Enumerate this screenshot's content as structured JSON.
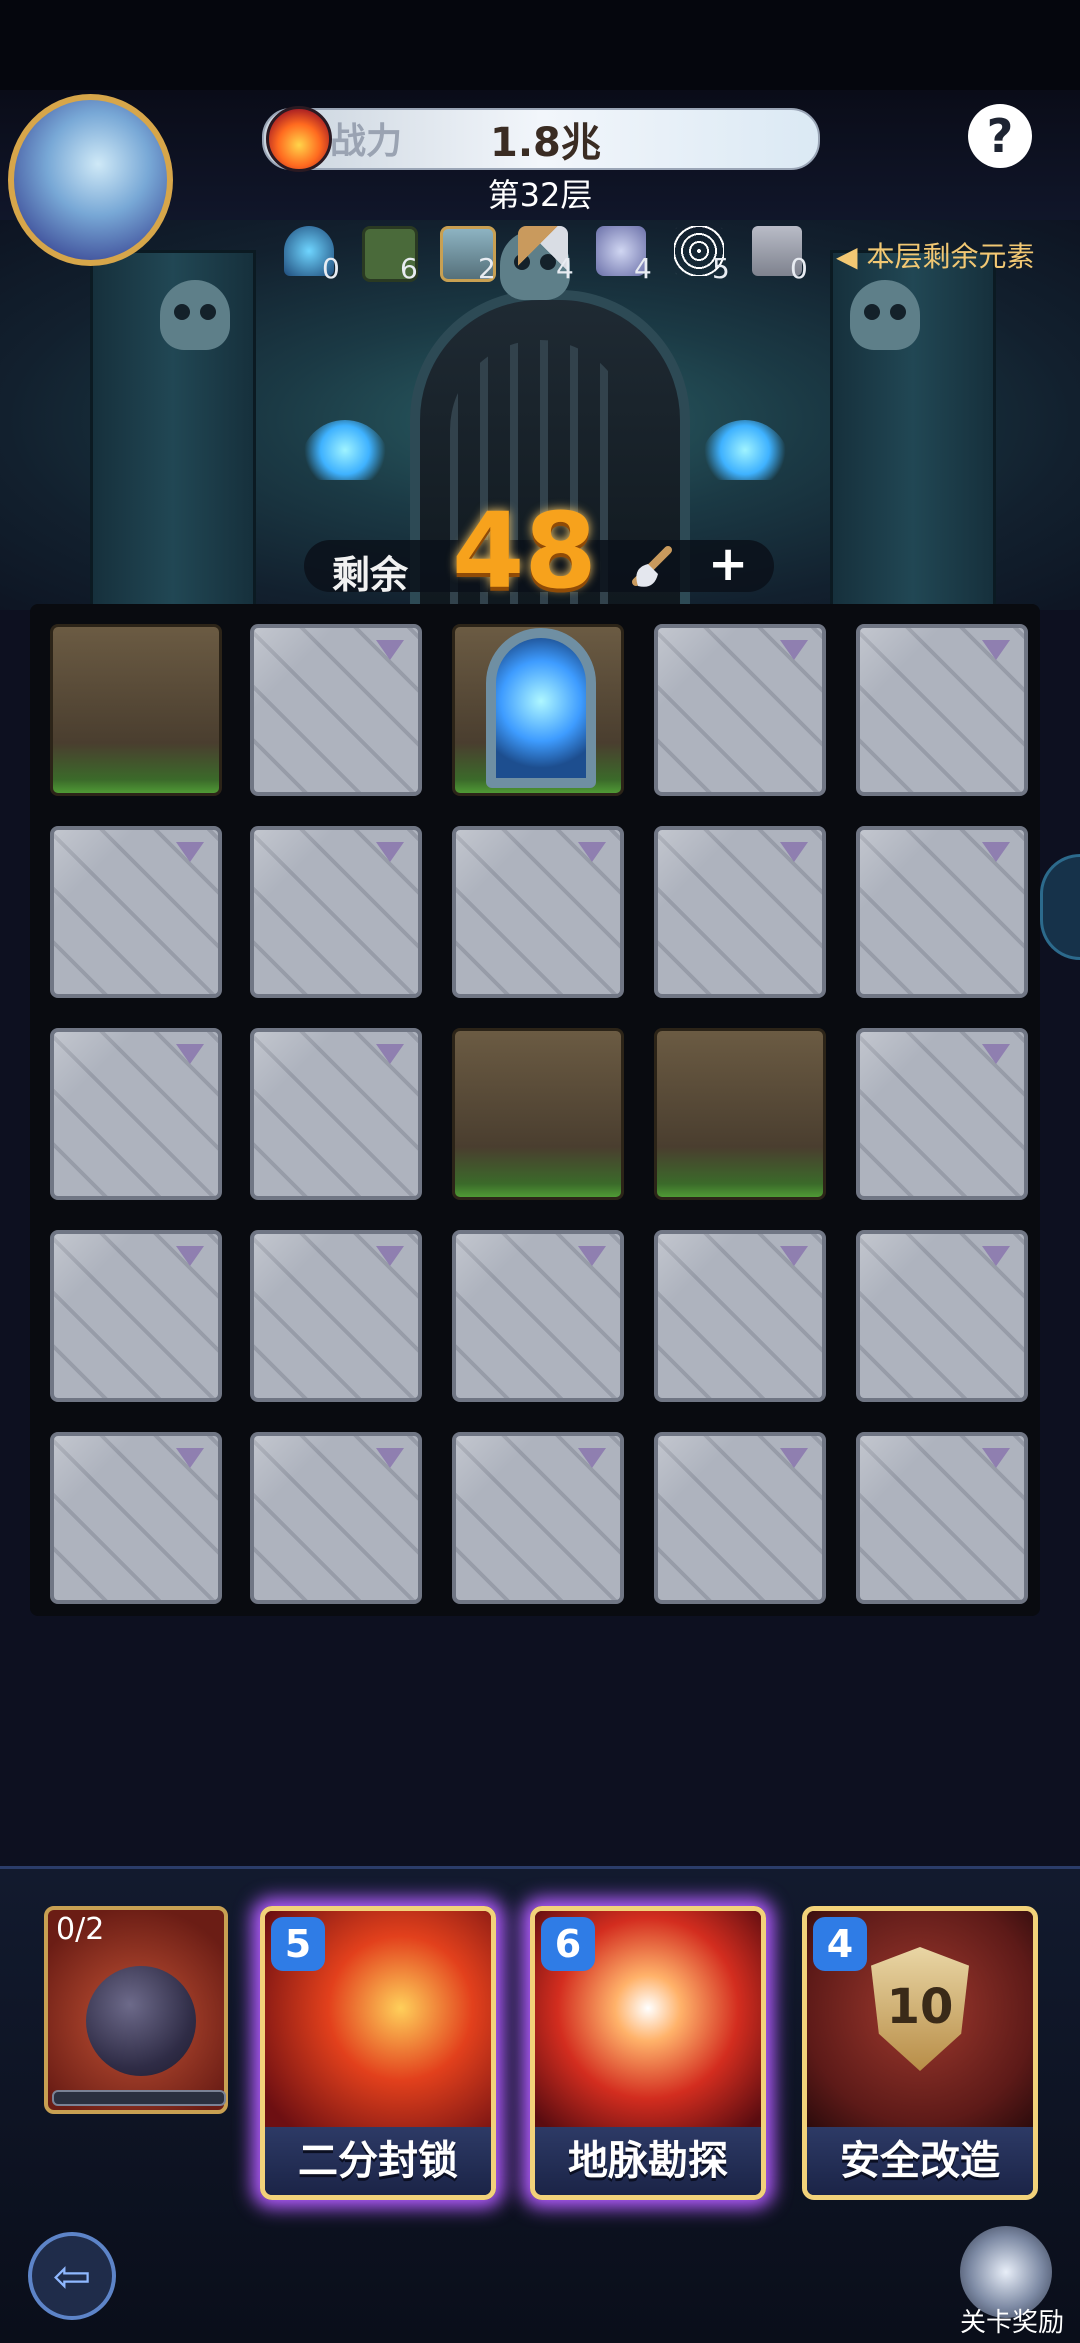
{
  "header": {
    "power_label": "战力",
    "power_value": "1.8兆",
    "help_label": "?",
    "floor_label": "第32层"
  },
  "elements": {
    "items": [
      {
        "icon": "portal-icon",
        "count": "0"
      },
      {
        "icon": "blocked-tile-icon",
        "count": "6"
      },
      {
        "icon": "locked-chest-icon",
        "count": "2"
      },
      {
        "icon": "pickaxe-icon",
        "count": "4"
      },
      {
        "icon": "crossed-swords-icon",
        "count": "4"
      },
      {
        "icon": "spider-web-icon",
        "count": "5"
      },
      {
        "icon": "scroll-icon",
        "count": "0"
      }
    ],
    "label": "本层剩余元素"
  },
  "remaining": {
    "label": "剩余",
    "count": "48",
    "plus": "+"
  },
  "board": {
    "rows": [
      [
        "dirt",
        "stone",
        "portal",
        "stone",
        "stone"
      ],
      [
        "stone",
        "stone",
        "stone",
        "stone",
        "stone"
      ],
      [
        "stone",
        "stone",
        "dirt",
        "dirt",
        "stone"
      ],
      [
        "stone",
        "stone",
        "stone",
        "stone",
        "stone"
      ],
      [
        "stone",
        "stone",
        "stone",
        "stone",
        "stone"
      ]
    ]
  },
  "cards": {
    "bomb": {
      "count": "0/2",
      "progress": 0.0
    },
    "skills": [
      {
        "cost": "5",
        "name": "二分封锁"
      },
      {
        "cost": "6",
        "name": "地脉勘探"
      },
      {
        "cost": "4",
        "name": "安全改造",
        "badge": "10"
      }
    ]
  },
  "footer": {
    "reward_label": "关卡奖励"
  },
  "colors": {
    "accent": "#f7a21c",
    "card_border": "#f2d27a",
    "glow": "#b35cff"
  }
}
